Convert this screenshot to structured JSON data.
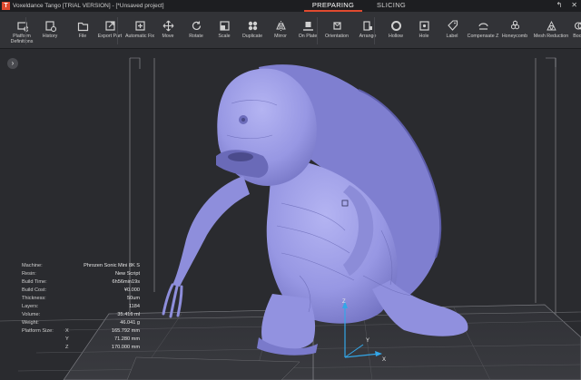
{
  "window": {
    "title": "Voxeldance Tango [TRIAL VERSION] - [*Unsaved project]",
    "mode_tabs": [
      "PREPARING",
      "SLICING"
    ],
    "active_tab": "PREPARING",
    "controls": [
      "↰",
      "✕"
    ]
  },
  "toolbar": {
    "tools": [
      {
        "id": "platform-definitions",
        "label": "Platform Definitions",
        "icon": "printer-settings-icon"
      },
      {
        "id": "history",
        "label": "History",
        "icon": "history-icon"
      },
      {
        "id": "file",
        "label": "File",
        "icon": "folder-icon"
      },
      {
        "id": "export-part",
        "label": "Export Part",
        "icon": "export-icon"
      },
      {
        "id": "automatic-fix",
        "label": "Automatic Fix",
        "icon": "plus-box-icon"
      },
      {
        "id": "move",
        "label": "Move",
        "icon": "move-arrows-icon"
      },
      {
        "id": "rotate",
        "label": "Rotate",
        "icon": "rotate-icon"
      },
      {
        "id": "scale",
        "label": "Scale",
        "icon": "scale-icon"
      },
      {
        "id": "duplicate",
        "label": "Duplicate",
        "icon": "duplicate-icon"
      },
      {
        "id": "mirror",
        "label": "Mirror",
        "icon": "mirror-icon"
      },
      {
        "id": "on-plate",
        "label": "On Plate",
        "icon": "on-plate-icon"
      },
      {
        "id": "orientation",
        "label": "Orientation",
        "icon": "orientation-icon"
      },
      {
        "id": "arrange",
        "label": "Arrange",
        "icon": "arrange-icon"
      },
      {
        "id": "hollow",
        "label": "Hollow",
        "icon": "hollow-circle-icon"
      },
      {
        "id": "hole",
        "label": "Hole",
        "icon": "hole-icon"
      },
      {
        "id": "label",
        "label": "Label",
        "icon": "tag-icon"
      },
      {
        "id": "compensate-z",
        "label": "Compensate Z",
        "icon": "compensate-icon"
      },
      {
        "id": "honeycomb",
        "label": "Honeycomb",
        "icon": "honeycomb-icon"
      },
      {
        "id": "mesh-reduction",
        "label": "Mesh Reduction",
        "icon": "mesh-reduction-icon"
      },
      {
        "id": "boolean",
        "label": "Boole",
        "icon": "boolean-icon"
      }
    ]
  },
  "viewport": {
    "collapse_glyph": "›",
    "model_color": "#9a9ae8",
    "axis_labels": {
      "x": "X",
      "y": "Y",
      "z": "Z"
    }
  },
  "info": {
    "rows": [
      {
        "key": "Machine:",
        "value": "Phrozen Sonic Mini 8K S"
      },
      {
        "key": "Resin:",
        "value": "New Script"
      },
      {
        "key": "Build Time:",
        "value": "6h56min19s"
      },
      {
        "key": "Build Cost:",
        "value": "¥0.000"
      },
      {
        "key": "Thickness:",
        "value": "50um"
      },
      {
        "key": "Layers:",
        "value": "1184"
      },
      {
        "key": "Volume:",
        "value": "35.416 ml"
      },
      {
        "key": "Weight:",
        "value": "46.041 g"
      },
      {
        "key": "Platform Size:",
        "sub": "X",
        "value": "165.792 mm"
      },
      {
        "key": "",
        "sub": "Y",
        "value": "71.280 mm"
      },
      {
        "key": "",
        "sub": "Z",
        "value": "170.000 mm"
      }
    ]
  }
}
